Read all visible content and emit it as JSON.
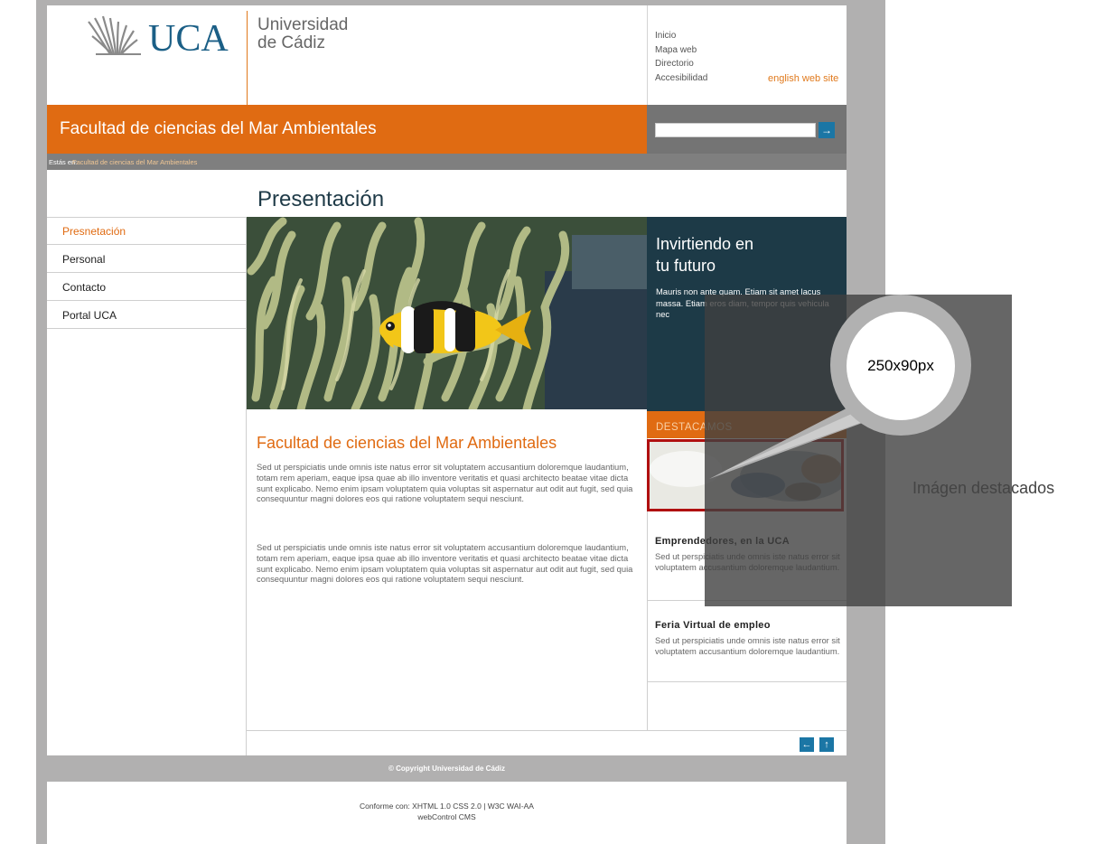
{
  "header": {
    "logo_text": "UCA",
    "university_line1": "Universidad",
    "university_line2": "de Cádiz",
    "top_links": [
      "Inicio",
      "Mapa web",
      "Directorio",
      "Accesibilidad"
    ],
    "english_link": "english web site"
  },
  "site_title": "Facultad de ciencias del Mar Ambientales",
  "search": {
    "button_icon": "arrow-right-icon"
  },
  "breadcrumb": {
    "label": "Estás en:",
    "current": "Facultad de ciencias del Mar Ambientales"
  },
  "page_title": "Presentación",
  "sidebar": {
    "items": [
      {
        "label": "Presnetación",
        "active": true
      },
      {
        "label": "Personal",
        "active": false
      },
      {
        "label": "Contacto",
        "active": false
      },
      {
        "label": "Portal UCA",
        "active": false
      }
    ]
  },
  "main": {
    "section_title": "Facultad de ciencias del Mar Ambientales",
    "paragraph1": "Sed ut perspiciatis unde omnis iste natus error sit voluptatem accusantium doloremque laudantium, totam rem aperiam, eaque ipsa quae ab illo inventore veritatis et quasi architecto beatae vitae dicta sunt explicabo. Nemo enim ipsam voluptatem quia voluptas sit aspernatur aut odit aut fugit, sed quia consequuntur magni dolores eos qui ratione voluptatem sequi nesciunt.",
    "paragraph2": "Sed ut perspiciatis unde omnis iste natus error sit voluptatem accusantium doloremque laudantium, totam rem aperiam, eaque ipsa quae ab illo inventore veritatis et quasi architecto beatae vitae dicta sunt explicabo. Nemo enim ipsam voluptatem quia voluptas sit aspernatur aut odit aut fugit, sed quia consequuntur magni dolores eos qui ratione voluptatem sequi nesciunt."
  },
  "promo": {
    "title_line1": "Invirtiendo en",
    "title_line2": "tu futuro",
    "text": "Mauris non ante quam. Etiam sit amet lacus massa. Etiam eros diam, tempor quis vehicula nec"
  },
  "destacamos": {
    "label": "DESTACAMOS",
    "news": [
      {
        "title": "Emprendedores, en la UCA",
        "text": "Sed ut perspiciatis unde omnis iste natus error sit voluptatem accusantium doloremque laudantium."
      },
      {
        "title": "Feria Virtual de empleo",
        "text": "Sed ut perspiciatis unde omnis iste natus error sit voluptatem accusantium doloremque laudantium."
      }
    ]
  },
  "page_nav": {
    "back_icon": "arrow-left-icon",
    "up_icon": "arrow-up-icon"
  },
  "footer": {
    "copyright": "© Copyright Universidad de Cádiz",
    "conformance": "Conforme con: XHTML 1.0  CSS 2.0  |   W3C  WAI-AA",
    "cms": "webControl CMS"
  },
  "annotation": {
    "size_label": "250x90px",
    "caption": "Imágen destacados"
  },
  "colors": {
    "orange": "#e06b12",
    "dark_teal": "#1d3a47",
    "blue_button": "#1b76a5",
    "grey_bg": "#b1b0b0",
    "highlight_border": "#b01010"
  }
}
